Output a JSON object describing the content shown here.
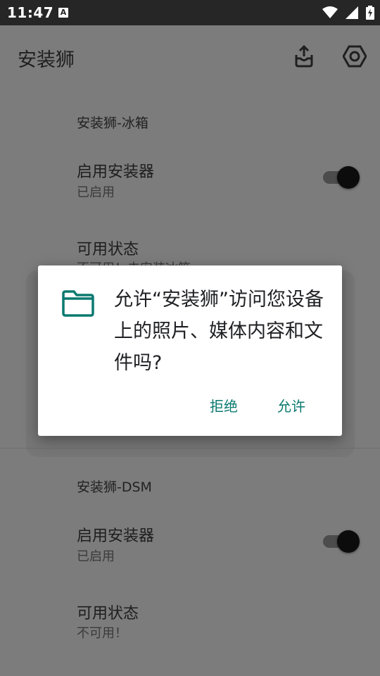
{
  "status_bar": {
    "time": "11:47",
    "notification_icon": "A",
    "icons": [
      "wifi-icon",
      "cell-signal-icon",
      "battery-charging-icon"
    ]
  },
  "app_bar": {
    "title": "安装狮",
    "actions": [
      "share-upload-icon",
      "settings-icon"
    ]
  },
  "sections": [
    {
      "title": "安装狮-冰箱",
      "rows": [
        {
          "title": "启用安装器",
          "subtitle": "已启用",
          "switch_on": true
        },
        {
          "title": "可用状态",
          "subtitle": "不可用！未安装冰箱"
        }
      ]
    },
    {
      "title": "安装狮-DSM",
      "rows": [
        {
          "title": "启用安装器",
          "subtitle": "已启用",
          "switch_on": true
        },
        {
          "title": "可用状态",
          "subtitle": "不可用！"
        }
      ]
    }
  ],
  "dialog": {
    "icon": "folder-icon",
    "message": "允许“安装狮”访问您设备上的照片、媒体内容和文件吗?",
    "deny_label": "拒绝",
    "allow_label": "允许"
  },
  "colors": {
    "accent": "#0b7a70",
    "scrim": "#7c7c7c",
    "status_bar": "#262626"
  }
}
